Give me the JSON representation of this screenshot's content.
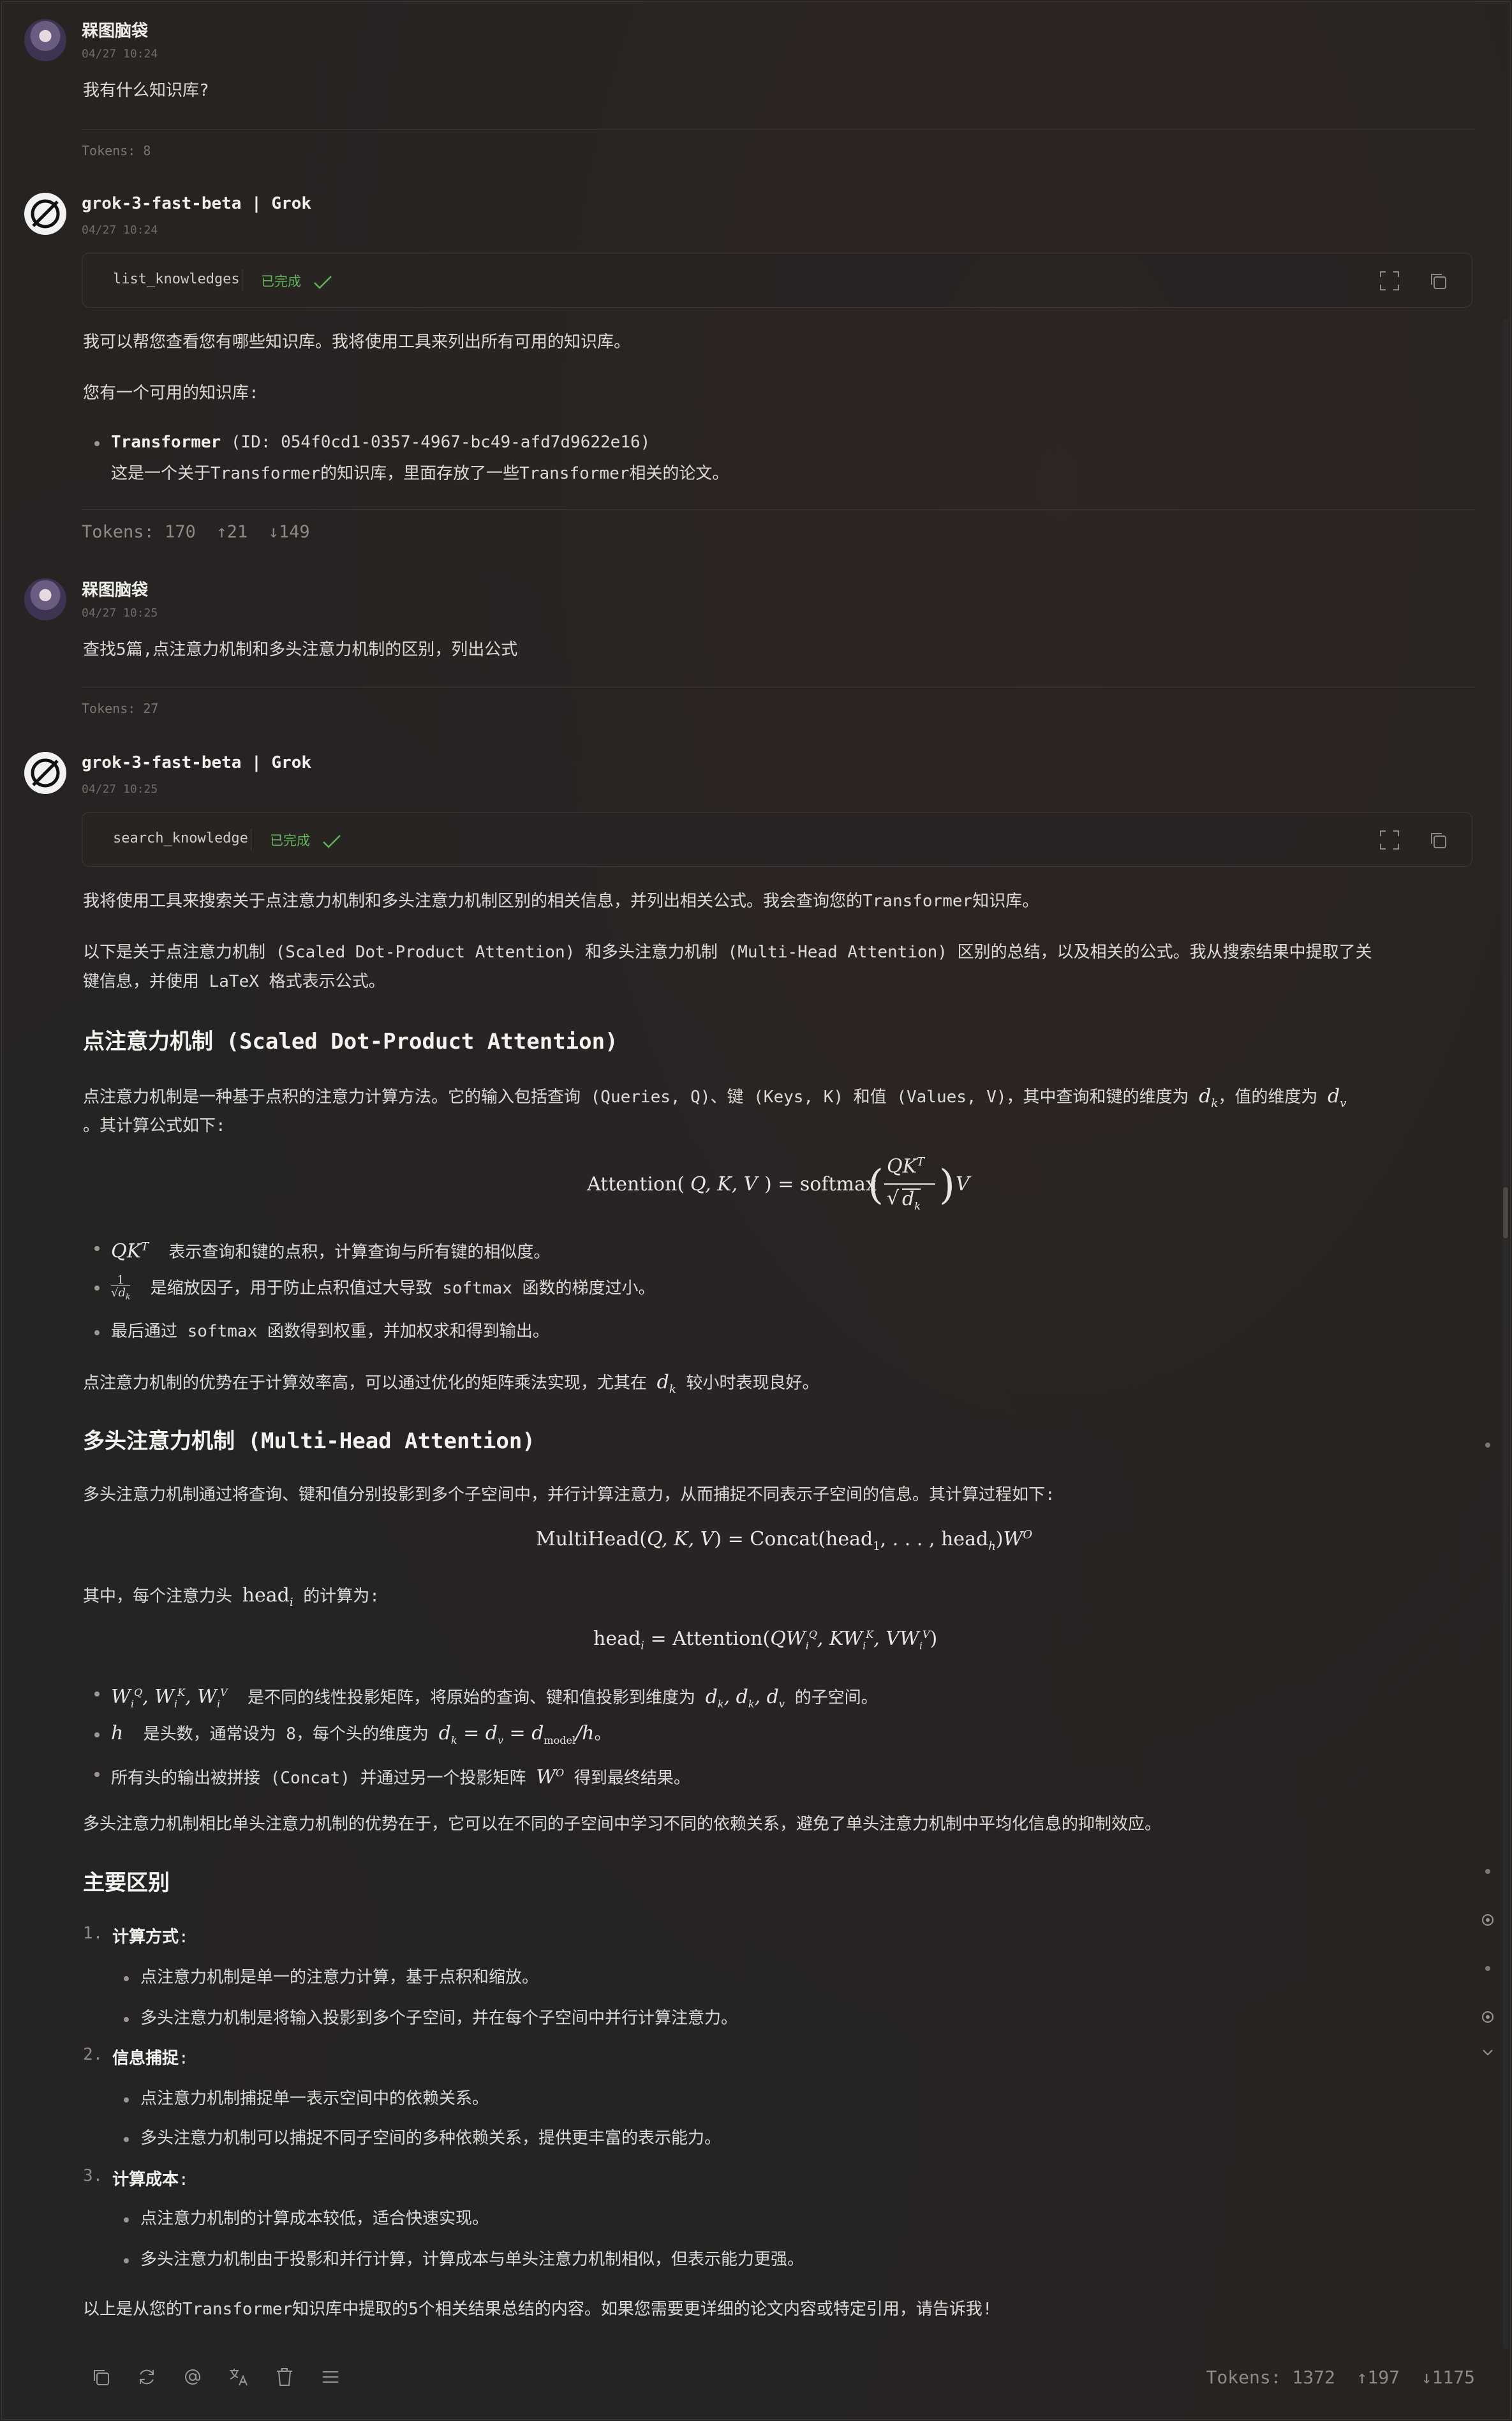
{
  "messages": [
    {
      "author": "槑图脑袋",
      "time": "04/27 10:24",
      "text": "我有什么知识库?",
      "tokens": "Tokens: 8"
    },
    {
      "author": "grok-3-fast-beta | Grok",
      "time": "04/27 10:24",
      "tool": {
        "name": "list_knowledges",
        "status": "已完成"
      },
      "intro": "我可以帮您查看您有哪些知识库。我将使用工具来列出所有可用的知识库。",
      "available": "您有一个可用的知识库:",
      "kb_name": "Transformer",
      "kb_id": "(ID: 054f0cd1-0357-4967-bc49-afd7d9622e16)",
      "kb_desc": "这是一个关于Transformer的知识库，里面存放了一些Transformer相关的论文。",
      "tokens": "Tokens: 170",
      "up": "21",
      "down": "149"
    },
    {
      "author": "槑图脑袋",
      "time": "04/27 10:25",
      "text": "查找5篇,点注意力机制和多头注意力机制的区别，列出公式",
      "tokens": "Tokens: 27"
    },
    {
      "author": "grok-3-fast-beta | Grok",
      "time": "04/27 10:25",
      "tool": {
        "name": "search_knowledge",
        "status": "已完成"
      }
    }
  ],
  "answer": {
    "p1": "我将使用工具来搜索关于点注意力机制和多头注意力机制区别的相关信息，并列出相关公式。我会查询您的Transformer知识库。",
    "p2a": "以下是关于点注意力机制 (Scaled Dot-Product Attention) 和多头注意力机制 (Multi-Head Attention) 区别的总结，以及相关的公式。我从搜索结果中提取了关",
    "p2b": "键信息，并使用 LaTeX 格式表示公式。",
    "h_dot": "点注意力机制 (Scaled Dot-Product Attention)",
    "dot_desc_a": "点注意力机制是一种基于点积的注意力计算方法。它的输入包括查询 (Queries, Q)、键 (Keys, K) 和值 (Values, V)，其中查询和键的维度为",
    "dot_desc_mid": "，值的维度为",
    "dot_desc_b": "。其计算公式如下:",
    "dot_b1": "表示查询和键的点积，计算查询与所有键的相似度。",
    "dot_b2": "是缩放因子，用于防止点积值过大导致 softmax 函数的梯度过小。",
    "dot_b3": "最后通过 softmax 函数得到权重，并加权求和得到输出。",
    "dot_adv_a": "点注意力机制的优势在于计算效率高，可以通过优化的矩阵乘法实现，尤其在",
    "dot_adv_b": "较小时表现良好。",
    "h_multi": "多头注意力机制 (Multi-Head Attention)",
    "multi_desc": "多头注意力机制通过将查询、键和值分别投影到多个子空间中，并行计算注意力，从而捕捉不同表示子空间的信息。其计算过程如下:",
    "multi_each_a": "其中，每个注意力头",
    "multi_each_b": "的计算为:",
    "multi_b1a": "是不同的线性投影矩阵，将原始的查询、键和值投影到维度为",
    "multi_b1b": "的子空间。",
    "multi_b2a": "是头数，通常设为 8，每个头的维度为",
    "multi_b3a": "所有头的输出被拼接 (Concat) 并通过另一个投影矩阵",
    "multi_b3b": "得到最终结果。",
    "multi_adv": "多头注意力机制相比单头注意力机制的优势在于，它可以在不同的子空间中学习不同的依赖关系，避免了单头注意力机制中平均化信息的抑制效应。",
    "h_diff": "主要区别",
    "diff": [
      {
        "num": "1.",
        "head": "计算方式",
        "items": [
          "点注意力机制是单一的注意力计算，基于点积和缩放。",
          "多头注意力机制是将输入投影到多个子空间，并在每个子空间中并行计算注意力。"
        ]
      },
      {
        "num": "2.",
        "head": "信息捕捉",
        "items": [
          "点注意力机制捕捉单一表示空间中的依赖关系。",
          "多头注意力机制可以捕捉不同子空间的多种依赖关系，提供更丰富的表示能力。"
        ]
      },
      {
        "num": "3.",
        "head": "计算成本",
        "items": [
          "点注意力机制的计算成本较低，适合快速实现。",
          "多头注意力机制由于投影和并行计算，计算成本与单头注意力机制相似，但表示能力更强。"
        ]
      }
    ],
    "closing": "以上是从您的Transformer知识库中提取的5个相关结果总结的内容。如果您需要更详细的论文内容或特定引用，请告诉我!"
  },
  "footer": {
    "tokens": "Tokens: 1372",
    "up": "197",
    "down": "1175"
  }
}
